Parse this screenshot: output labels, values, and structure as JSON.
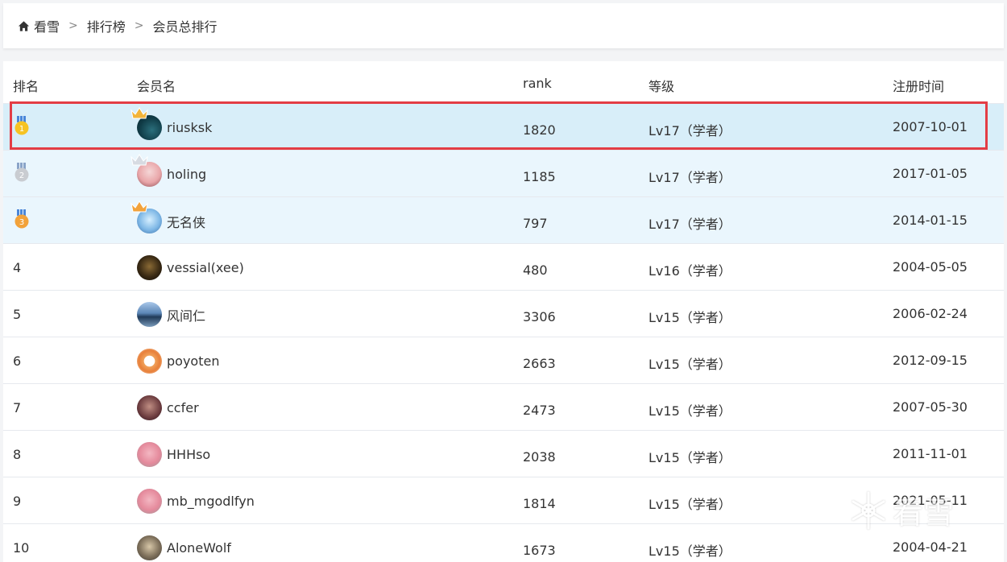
{
  "breadcrumb": {
    "home": "看雪",
    "separator": ">",
    "section": "排行榜",
    "current": "会员总排行"
  },
  "table": {
    "headers": {
      "rank": "排名",
      "member": "会员名",
      "score": "rank",
      "level": "等级",
      "registered": "注册时间"
    },
    "rows": [
      {
        "rank": "1",
        "medal": "gold",
        "name": "riusksk",
        "score": "1820",
        "level": "Lv17（学者）",
        "date": "2007-10-01"
      },
      {
        "rank": "2",
        "medal": "silver",
        "name": "holing",
        "score": "1185",
        "level": "Lv17（学者）",
        "date": "2017-01-05"
      },
      {
        "rank": "3",
        "medal": "bronze",
        "name": "无名侠",
        "score": "797",
        "level": "Lv17（学者）",
        "date": "2014-01-15"
      },
      {
        "rank": "4",
        "name": "vessial(xee)",
        "score": "480",
        "level": "Lv16（学者）",
        "date": "2004-05-05"
      },
      {
        "rank": "5",
        "name": "风间仁",
        "score": "3306",
        "level": "Lv15（学者）",
        "date": "2006-02-24"
      },
      {
        "rank": "6",
        "name": "poyoten",
        "score": "2663",
        "level": "Lv15（学者）",
        "date": "2012-09-15"
      },
      {
        "rank": "7",
        "name": "ccfer",
        "score": "2473",
        "level": "Lv15（学者）",
        "date": "2007-05-30"
      },
      {
        "rank": "8",
        "name": "HHHso",
        "score": "2038",
        "level": "Lv15（学者）",
        "date": "2011-11-01"
      },
      {
        "rank": "9",
        "name": "mb_mgodlfyn",
        "score": "1814",
        "level": "Lv15（学者）",
        "date": "2021-05-11"
      },
      {
        "rank": "10",
        "name": "AloneWolf",
        "score": "1673",
        "level": "Lv15（学者）",
        "date": "2004-04-21"
      }
    ]
  },
  "watermark": {
    "text": "看雪"
  },
  "colors": {
    "highlight_border": "#e33d45",
    "top1_row": "#d8eef9",
    "top3_row": "#eaf6fd",
    "gold": "#f6c324",
    "silver": "#c9ccd1",
    "bronze": "#f2a23a",
    "ribbon": "#4a86d8"
  },
  "icons": {
    "home": "home-icon",
    "crown": "crown-icon",
    "medals": [
      "gold-medal-icon",
      "silver-medal-icon",
      "bronze-medal-icon"
    ],
    "watermark_logo": "snowflake-logo-icon"
  }
}
